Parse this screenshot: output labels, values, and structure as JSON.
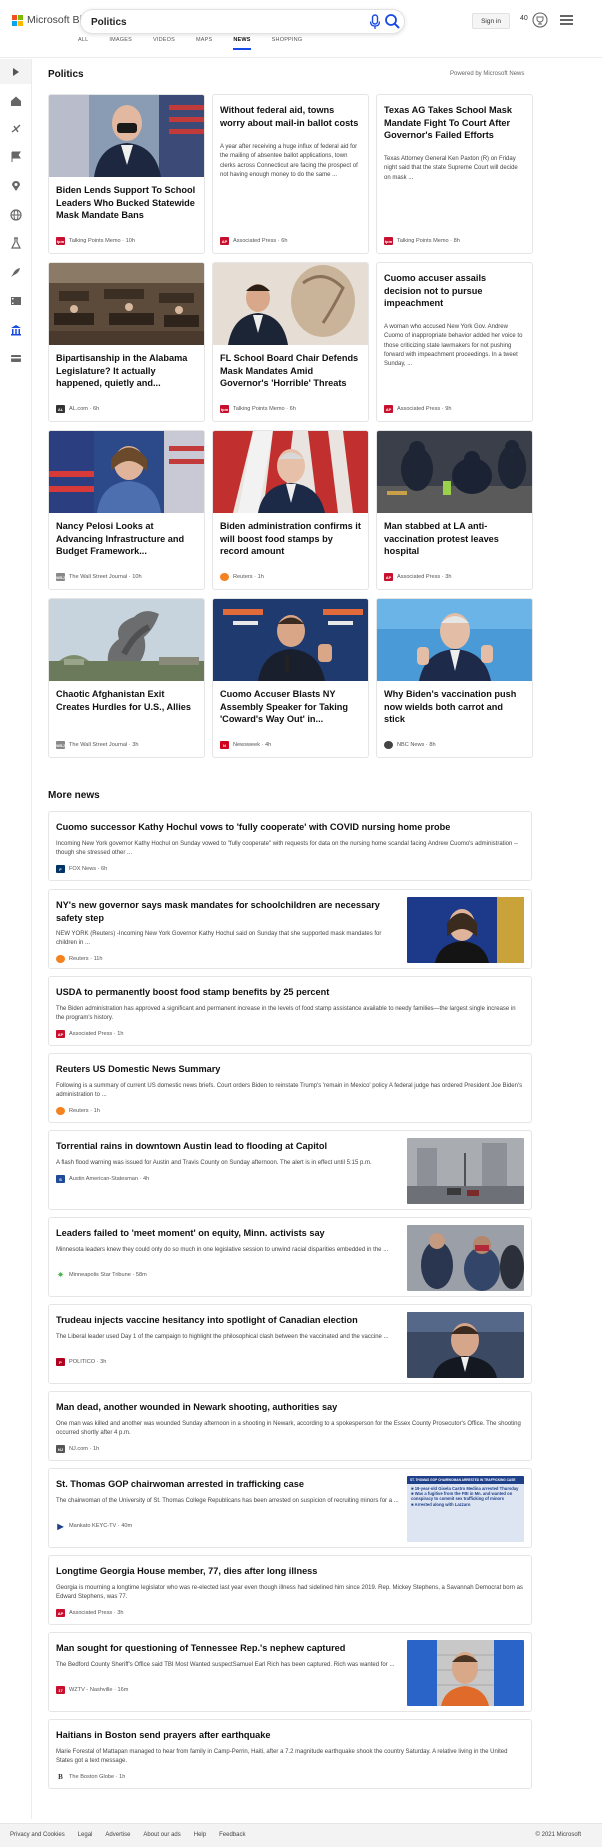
{
  "header": {
    "brand": "Microsoft Bing",
    "search_value": "Politics",
    "signin_label": "Sign in",
    "points": "40",
    "brand_colors": [
      "#f25022",
      "#7fba00",
      "#00a4ef",
      "#ffb900"
    ],
    "accent_color": "#174ae4"
  },
  "tabs": [
    "ALL",
    "IMAGES",
    "VIDEOS",
    "MAPS",
    "NEWS",
    "SHOPPING"
  ],
  "active_tab": "NEWS",
  "rail_icons": [
    "expand-icon",
    "home-icon",
    "discover-icon",
    "flag-icon",
    "location-icon",
    "globe-icon",
    "science-icon",
    "rocket-icon",
    "movie-icon",
    "politics-icon",
    "credit-card-icon"
  ],
  "section": {
    "title": "Politics",
    "powered_by": "Powered by Microsoft News"
  },
  "cards": [
    {
      "title": "Biden Lends Support To School Leaders Who Bucked Statewide Mask Mandate Bans",
      "source": "Talking Points Memo",
      "time": "10h",
      "image": "biden-mask-photo",
      "badge_color": "#c8102e"
    },
    {
      "title": "Without federal aid, towns worry about mail-in ballot costs",
      "snippet": "A year after receiving a huge influx of federal aid for the mailing of absentee ballot applications, town clerks across Connecticut are facing the prospect of not having enough money to do the same ...",
      "source": "Associated Press",
      "time": "6h",
      "badge_color": "#c8102e"
    },
    {
      "title": "Texas AG Takes School Mask Mandate Fight To Court After Governor's Failed Efforts",
      "snippet": "Texas Attorney General Ken Paxton (R) on Friday night said that the state Supreme Court will decide on mask ...",
      "source": "Talking Points Memo",
      "time": "8h",
      "badge_color": "#c8102e"
    },
    {
      "title": "Bipartisanship in the Alabama Legislature? It actually happened, quietly and...",
      "source": "AL.com",
      "time": "6h",
      "image": "legislature-chamber-photo",
      "badge_color": "#333333"
    },
    {
      "title": "FL School Board Chair Defends Mask Mandates Amid Governor's 'Horrible' Threats",
      "source": "Talking Points Memo",
      "time": "6h",
      "image": "desantis-photo",
      "badge_color": "#c8102e"
    },
    {
      "title": "Cuomo accuser assails decision not to pursue impeachment",
      "snippet": "A woman who accused New York Gov. Andrew Cuomo of inappropriate behavior added her voice to those criticizing state lawmakers for not pushing forward with impeachment proceedings. In a tweet Sunday, ...",
      "source": "Associated Press",
      "time": "9h",
      "badge_color": "#c8102e"
    },
    {
      "title": "Nancy Pelosi Looks at Advancing Infrastructure and Budget Framework...",
      "source": "The Wall Street Journal",
      "time": "10h",
      "image": "pelosi-photo",
      "badge_color": "#888888"
    },
    {
      "title": "Biden administration confirms it will boost food stamps by record amount",
      "source": "Reuters",
      "time": "1h",
      "image": "biden-flags-photo",
      "badge_color": "#f58220"
    },
    {
      "title": "Man stabbed at LA anti-vaccination protest leaves hospital",
      "source": "Associated Press",
      "time": "3h",
      "image": "police-protest-photo",
      "badge_color": "#c8102e"
    },
    {
      "title": "Chaotic Afghanistan Exit Creates Hurdles for U.S., Allies",
      "source": "The Wall Street Journal",
      "time": "3h",
      "image": "kabul-smoke-photo",
      "badge_color": "#888888"
    },
    {
      "title": "Cuomo Accuser Blasts NY Assembly Speaker for Taking 'Coward's Way Out' in...",
      "source": "Newsweek",
      "time": "4h",
      "image": "cuomo-photo",
      "badge_color": "#d0021b"
    },
    {
      "title": "Why Biden's vaccination push now wields both carrot and stick",
      "source": "NBC News",
      "time": "8h",
      "image": "biden-blue-photo",
      "badge_color": "#444444"
    }
  ],
  "more_news_title": "More news",
  "news": [
    {
      "title": "Cuomo successor Kathy Hochul vows to 'fully cooperate' with COVID nursing home probe",
      "snippet": "Incoming New York governor Kathy Hochul on Sunday vowed to \"fully cooperate\" with requests for data on the nursing home scandal facing Andrew Cuomo's administration -- though she stressed other ...",
      "source": "FOX News",
      "time": "6h",
      "badge_color": "#003366"
    },
    {
      "title": "NY's new governor says mask mandates for schoolchildren are necessary safety step",
      "snippet": "NEW YORK (Reuters) -Incoming New York Governor Kathy Hochul said on Sunday that she supported mask mandates for children in ...",
      "source": "Reuters",
      "time": "11h",
      "image": "hochul-photo",
      "badge_color": "#f58220"
    },
    {
      "title": "USDA to permanently boost food stamp benefits by 25 percent",
      "snippet": "The Biden administration has approved a significant and permanent increase in the levels of food stamp assistance available to needy families—the largest single increase in the program's history.",
      "source": "Associated Press",
      "time": "1h",
      "badge_color": "#c8102e"
    },
    {
      "title": "Reuters US Domestic News Summary",
      "snippet": "Following is a summary of current US domestic news briefs. Court orders Biden to reinstate Trump's 'remain in Mexico' policy A federal judge has ordered President Joe Biden's administration to ...",
      "source": "Reuters",
      "time": "1h",
      "badge_color": "#f58220"
    },
    {
      "title": "Torrential rains in downtown Austin lead to flooding at Capitol",
      "snippet": "A flash flood warning was issued for Austin and Travis County on Sunday afternoon. The alert is in effect until 5:15 p.m.",
      "source": "Austin American-Statesman",
      "time": "4h",
      "image": "austin-rain-photo",
      "badge_color": "#1e4c9a"
    },
    {
      "title": "Leaders failed to 'meet moment' on equity, Minn. activists say",
      "snippet": "Minnesota leaders knew they could only do so much in one legislative session to unwind racial disparities embedded in the ...",
      "source": "Minneapolis Star Tribune",
      "time": "58m",
      "image": "activists-photo",
      "badge_color": "#4caf50"
    },
    {
      "title": "Trudeau injects vaccine hesitancy into spotlight of Canadian election",
      "snippet": "The Liberal leader used Day 1 of the campaign to highlight the philosophical clash between the vaccinated and the vaccine ...",
      "source": "POLITICO",
      "time": "3h",
      "image": "trudeau-photo",
      "badge_color": "#b0001e"
    },
    {
      "title": "Man dead, another wounded in Newark shooting, authorities say",
      "snippet": "One man was killed and another was wounded Sunday afternoon in a shooting in Newark, according to a spokesperson for the Essex County Prosecutor's Office. The shooting occurred shortly after 4 p.m.",
      "source": "NJ.com",
      "time": "1h",
      "badge_color": "#555555"
    },
    {
      "title": "St. Thomas GOP chairwoman arrested in trafficking case",
      "snippet": "The chairwoman of the University of St. Thomas College Republicans has been arrested on suspicion of recruiting minors for a ...",
      "source": "Mankato KEYC-TV",
      "time": "40m",
      "image": "keyc-graphic",
      "badge_color": "#1e3f8a"
    },
    {
      "title": "Longtime Georgia House member, 77, dies after long illness",
      "snippet": "Georgia is mourning a longtime legislator who was re-elected last year even though illness had sidelined him since 2019. Rep. Mickey Stephens, a Savannah Democrat born as Edward Stephens, was 77.",
      "source": "Associated Press",
      "time": "3h",
      "badge_color": "#c8102e"
    },
    {
      "title": "Man sought for questioning of Tennessee Rep.'s nephew captured",
      "snippet": "The Bedford County Sheriff's Office said TBI Most Wanted suspectSamuel Earl Rich has been captured. Rich was wanted for ...",
      "source": "WZTV - Nashville",
      "time": "16m",
      "image": "mugshot-photo",
      "badge_color": "#c8102e"
    },
    {
      "title": "Haitians in Boston send prayers after earthquake",
      "snippet": "Marie Forestal of Mattapan managed to hear from family in Camp-Perrin, Haiti, after a 7.2 magnitude earthquake shook the country Saturday. A relative living in the United States got a text message.",
      "source": "The Boston Globe",
      "time": "1h",
      "badge_color": "#333333"
    }
  ],
  "keyc_graphic_text": {
    "banner": "ST. THOMAS GOP CHAIRWOMAN ARRESTED IN TRAFFICKING CASE",
    "bullets": [
      "19-year-old Gisela Castro Medina arrested Thursday",
      "Was a fugitive from the FBI in Mn. and wanted on conspiracy to commit sex trafficking of minors",
      "Arrested along with Lazzaro"
    ]
  },
  "footer": {
    "links": [
      "Privacy and Cookies",
      "Legal",
      "Advertise",
      "About our ads",
      "Help",
      "Feedback"
    ],
    "copyright": "© 2021 Microsoft"
  }
}
